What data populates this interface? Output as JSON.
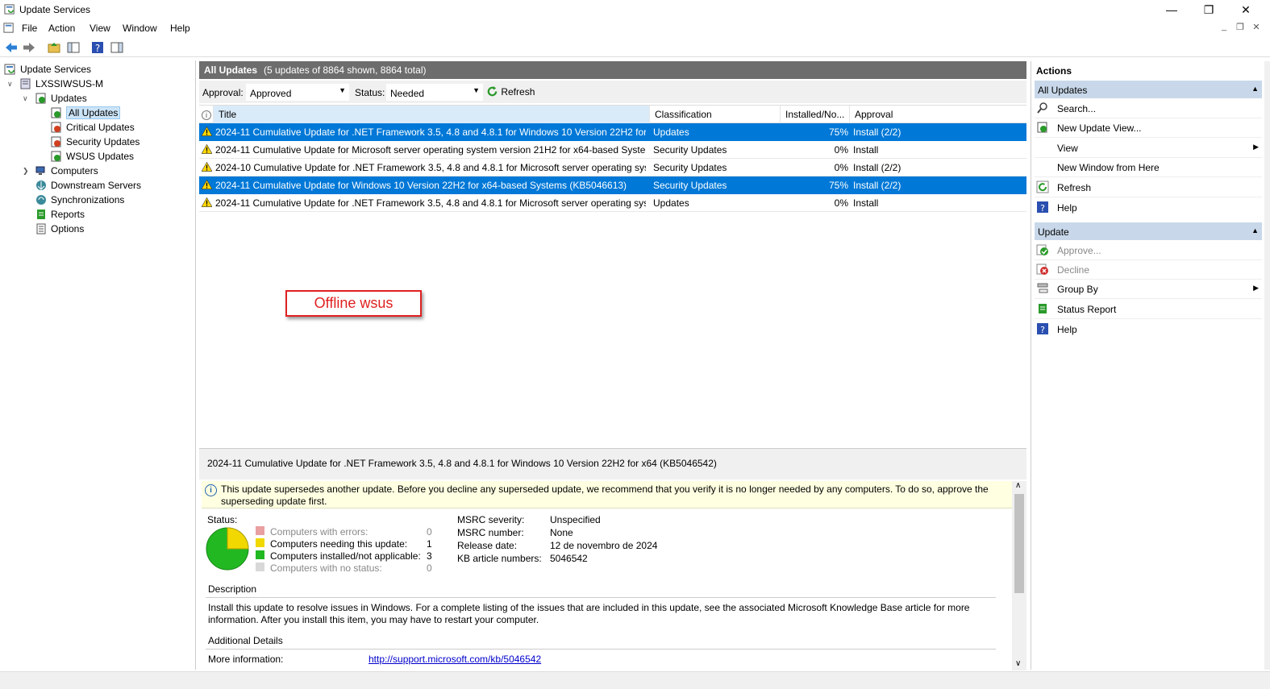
{
  "window": {
    "title": "Update Services"
  },
  "menu": [
    "File",
    "Action",
    "View",
    "Window",
    "Help"
  ],
  "tree": {
    "root": "Update Services",
    "server": "LXSSIWSUS-M",
    "updates": "Updates",
    "all_updates": "All Updates",
    "critical": "Critical Updates",
    "security": "Security Updates",
    "wsus": "WSUS Updates",
    "computers": "Computers",
    "downstream": "Downstream Servers",
    "sync": "Synchronizations",
    "reports": "Reports",
    "options": "Options"
  },
  "header": {
    "title": "All Updates",
    "summary": "(5 updates of 8864 shown, 8864 total)"
  },
  "filter": {
    "approval_label": "Approval:",
    "approval_value": "Approved",
    "status_label": "Status:",
    "status_value": "Needed",
    "refresh_label": "Refresh"
  },
  "grid": {
    "columns": {
      "title": "Title",
      "classification": "Classification",
      "installed": "Installed/No...",
      "approval": "Approval"
    },
    "rows": [
      {
        "title": "2024-11 Cumulative Update for .NET Framework 3.5, 4.8 and 4.8.1 for Windows 10 Version 22H2 for x...",
        "classification": "Updates",
        "installed": "75%",
        "approval": "Install (2/2)"
      },
      {
        "title": "2024-11 Cumulative Update for Microsoft server operating system version 21H2 for x64-based Syste...",
        "classification": "Security Updates",
        "installed": "0%",
        "approval": "Install"
      },
      {
        "title": "2024-10 Cumulative Update for .NET Framework 3.5, 4.8 and 4.8.1 for Microsoft server operating syst...",
        "classification": "Security Updates",
        "installed": "0%",
        "approval": "Install (2/2)"
      },
      {
        "title": "2024-11 Cumulative Update for Windows 10 Version 22H2 for x64-based Systems (KB5046613)",
        "classification": "Security Updates",
        "installed": "75%",
        "approval": "Install (2/2)"
      },
      {
        "title": "2024-11 Cumulative Update for .NET Framework 3.5, 4.8 and 4.8.1 for Microsoft server operating syst...",
        "classification": "Updates",
        "installed": "0%",
        "approval": "Install"
      }
    ]
  },
  "annotation": "Offline wsus",
  "detail": {
    "title": "2024-11 Cumulative Update for .NET Framework 3.5, 4.8 and 4.8.1 for Windows 10 Version 22H2 for x64 (KB5046542)",
    "info": "This update supersedes another update. Before you decline any superseded update, we recommend that you verify it is no longer needed by any computers. To do so, approve the superseding update first.",
    "status_label": "Status:",
    "legend": [
      {
        "label": "Computers with errors:",
        "count": "0",
        "color": "#e8a0a0"
      },
      {
        "label": "Computers needing this update:",
        "count": "1",
        "color": "#f0d800"
      },
      {
        "label": "Computers installed/not applicable:",
        "count": "3",
        "color": "#22b822"
      },
      {
        "label": "Computers with no status:",
        "count": "0",
        "color": "#d8d8d8"
      }
    ],
    "props": [
      {
        "k": "MSRC severity:",
        "v": "Unspecified"
      },
      {
        "k": "MSRC number:",
        "v": "None"
      },
      {
        "k": "Release date:",
        "v": "12 de novembro de 2024"
      },
      {
        "k": "KB article numbers:",
        "v": "5046542"
      }
    ],
    "description_heading": "Description",
    "description": "Install this update to resolve issues in Windows. For a complete listing of the issues that are included in this update, see the associated Microsoft Knowledge Base article for more information. After you install this item, you may have to restart your computer.",
    "additional_heading": "Additional Details",
    "more_info_label": "More information:",
    "more_info_link": "http://support.microsoft.com/kb/5046542"
  },
  "actions": {
    "title": "Actions",
    "group1": "All Updates",
    "group1_items": [
      "Search...",
      "New Update View...",
      "View",
      "New Window from Here",
      "Refresh",
      "Help"
    ],
    "group2": "Update",
    "group2_items": [
      "Approve...",
      "Decline",
      "Group By",
      "Status Report",
      "Help"
    ]
  }
}
